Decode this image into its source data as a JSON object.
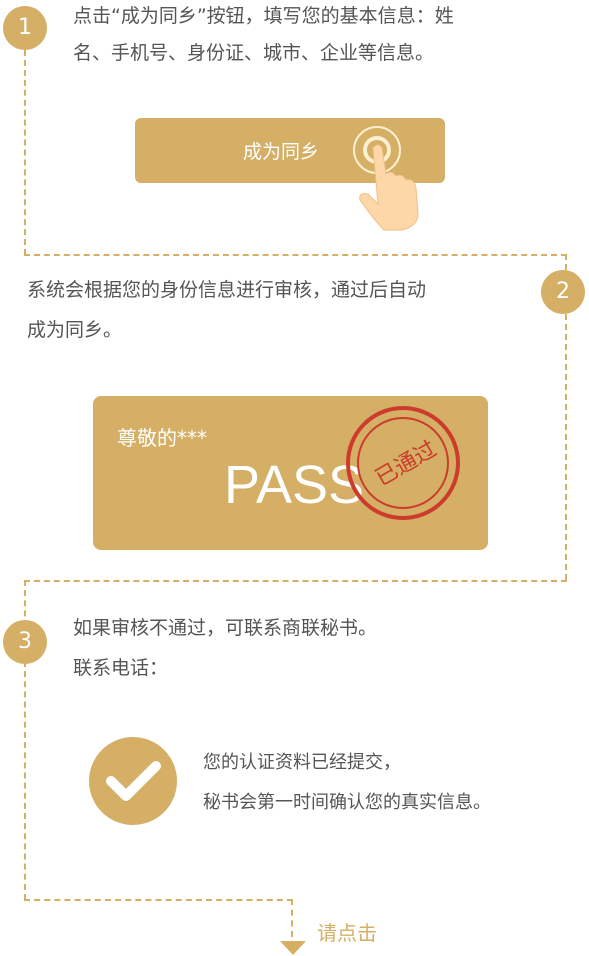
{
  "steps": [
    {
      "number": "1",
      "text_line1": "点击“成为同乡”按钮，填写您的基本信息：姓",
      "text_line2": "名、手机号、身份证、城市、企业等信息。",
      "button_label": "成为同乡"
    },
    {
      "number": "2",
      "text_line1": "系统会根据您的身份信息进行审核，通过后自动",
      "text_line2": "成为同乡。",
      "card_greeting": "尊敬的***",
      "card_pass": "PASS",
      "stamp_text": "已通过"
    },
    {
      "number": "3",
      "text_line1": "如果审核不通过，可联系商联秘书。",
      "text_line2": "联系电话：",
      "confirm_line1": "您的认证资料已经提交，",
      "confirm_line2": "秘书会第一时间确认您的真实信息。"
    }
  ],
  "footer_link": "请点击",
  "colors": {
    "accent": "#d4af65",
    "stamp": "#cc3b2b",
    "text": "#555555"
  }
}
